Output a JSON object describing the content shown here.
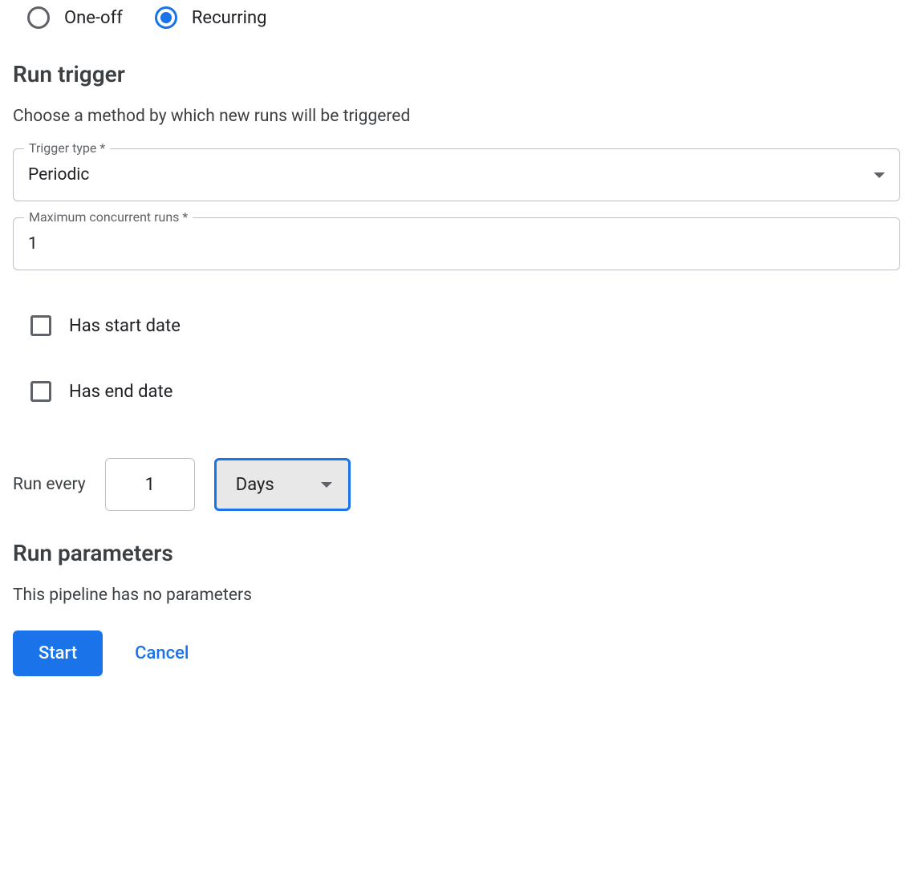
{
  "schedule_type": {
    "options": [
      {
        "label": "One-off",
        "selected": false
      },
      {
        "label": "Recurring",
        "selected": true
      }
    ]
  },
  "run_trigger": {
    "title": "Run trigger",
    "description": "Choose a method by which new runs will be triggered",
    "trigger_type": {
      "label": "Trigger type *",
      "value": "Periodic"
    },
    "max_concurrent": {
      "label": "Maximum concurrent runs *",
      "value": "1"
    },
    "has_start_date": {
      "label": "Has start date",
      "checked": false
    },
    "has_end_date": {
      "label": "Has end date",
      "checked": false
    },
    "run_every": {
      "label": "Run every",
      "value": "1",
      "unit": "Days"
    }
  },
  "run_parameters": {
    "title": "Run parameters",
    "empty_message": "This pipeline has no parameters"
  },
  "actions": {
    "start_label": "Start",
    "cancel_label": "Cancel"
  }
}
